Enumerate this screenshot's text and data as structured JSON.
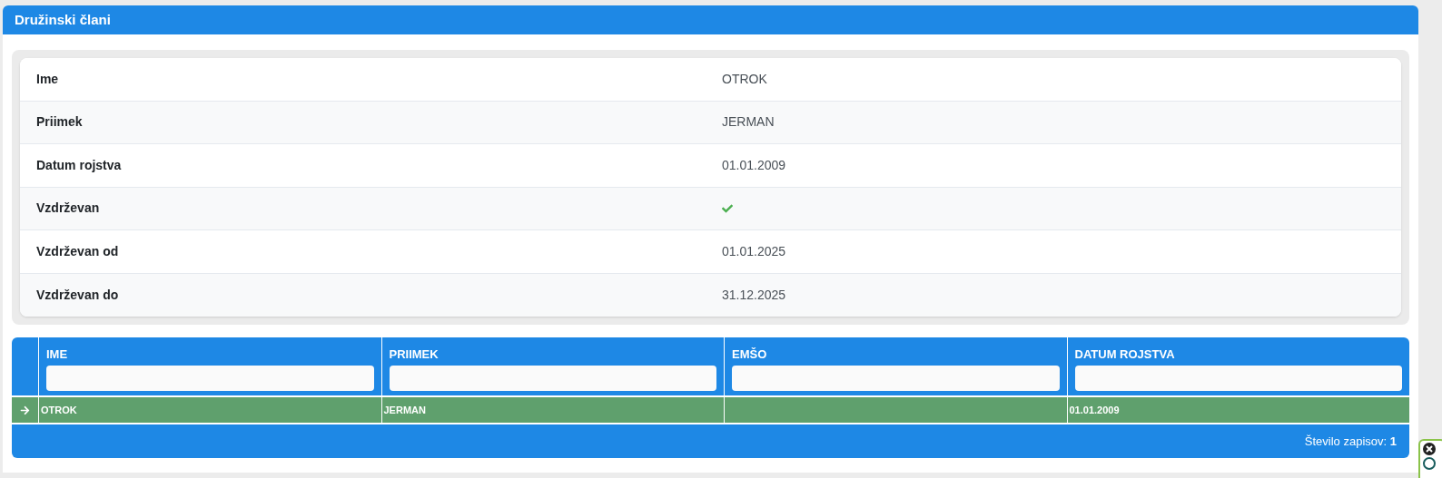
{
  "panel": {
    "title": "Družinski člani"
  },
  "details": [
    {
      "label": "Ime",
      "kind": "text",
      "value": "OTROK"
    },
    {
      "label": "Priimek",
      "kind": "text",
      "value": "JERMAN"
    },
    {
      "label": "Datum rojstva",
      "kind": "text",
      "value": "01.01.2009"
    },
    {
      "label": "Vzdrževan",
      "kind": "check",
      "checked": true
    },
    {
      "label": "Vzdrževan od",
      "kind": "text",
      "value": "01.01.2025"
    },
    {
      "label": "Vzdrževan do",
      "kind": "text",
      "value": "31.12.2025"
    }
  ],
  "table": {
    "columns": [
      "IME",
      "PRIIMEK",
      "EMŠO",
      "DATUM ROJSTVA"
    ],
    "rows": [
      {
        "selected": true,
        "cells": [
          "OTROK",
          "JERMAN",
          "",
          "01.01.2009"
        ]
      }
    ],
    "footer": "Število zapisov: **1**"
  }
}
